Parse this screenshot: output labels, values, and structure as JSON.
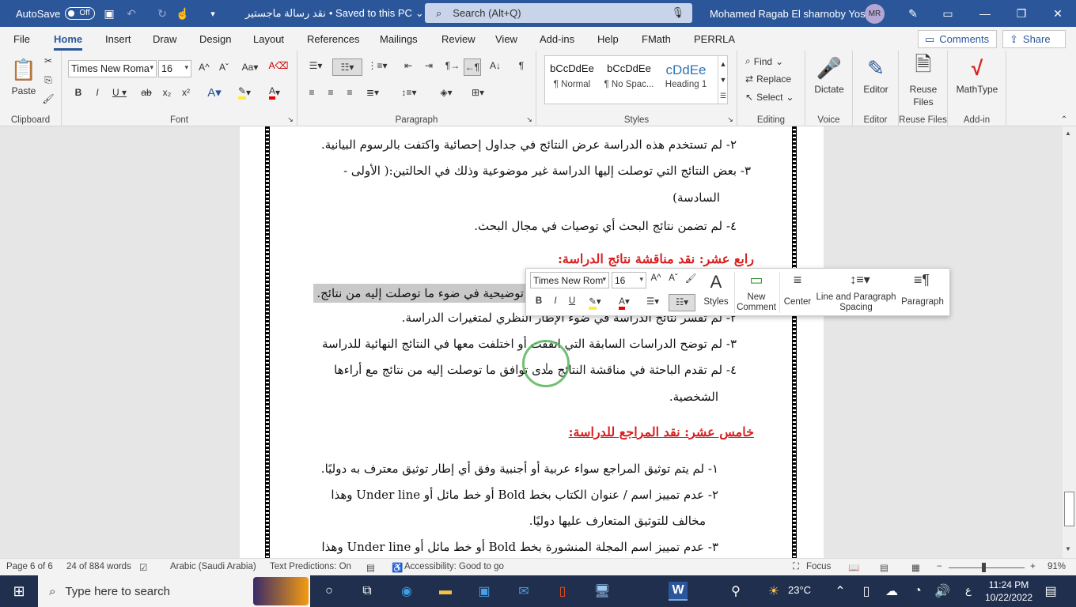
{
  "titlebar": {
    "autosave_label": "AutoSave",
    "autosave_state": "Off",
    "doc_name": "نقد رسالة ماجستير",
    "save_state": "• Saved to this PC",
    "search_placeholder": "Search (Alt+Q)",
    "user_name": "Mohamed Ragab El sharnoby Yosef",
    "user_initials": "MR"
  },
  "menu": {
    "tabs": [
      "File",
      "Home",
      "Insert",
      "Draw",
      "Design",
      "Layout",
      "References",
      "Mailings",
      "Review",
      "View",
      "Add-ins",
      "Help",
      "FMath",
      "PERRLA"
    ],
    "comments": "Comments",
    "share": "Share"
  },
  "ribbon": {
    "clipboard": {
      "paste": "Paste",
      "label": "Clipboard"
    },
    "font": {
      "name": "Times New Roma",
      "size": "16",
      "label": "Font"
    },
    "paragraph": {
      "label": "Paragraph"
    },
    "styles": {
      "label": "Styles",
      "items": [
        {
          "sample": "bCcDdEe",
          "name": "¶ Normal"
        },
        {
          "sample": "bCcDdEe",
          "name": "¶ No Spac..."
        },
        {
          "sample": "cDdEe",
          "name": "Heading 1"
        }
      ]
    },
    "editing": {
      "find": "Find",
      "replace": "Replace",
      "select": "Select",
      "label": "Editing"
    },
    "voice": {
      "dictate": "Dictate",
      "label": "Voice"
    },
    "editor": {
      "editor": "Editor",
      "label": "Editor"
    },
    "reuse": {
      "line1": "Reuse",
      "line2": "Files",
      "label": "Reuse Files"
    },
    "addin": {
      "mathtype": "MathType",
      "label": "Add-in"
    }
  },
  "document": {
    "lines": [
      "٢- لم تستخدم هذه الدراسة عرض النتائج في جداول إحصائية واكتفت بالرسوم البيانية.",
      "٣- بعض النتائج التي توصلت إليها الدراسة غير موضوعية وذلك في الحالتين:( الأولى -",
      "السادسة)",
      "٤- لم تضمن نتائج البحث أي توصيات في مجال البحث.",
      "رابع عشر: نقد مناقشة نتائج الدراسة:",
      "توضيحية في ضوء ما توصلت إليه من نتائج.",
      "٢- لم تفسر نتائج الدراسة في ضوء الإطار النظري لمتغيرات الدراسة.",
      "٣- لم توضح الدراسات السابقة التي اتفقت أو اختلفت معها في النتائج النهائية للدراسة",
      "٤- لم تقدم الباحثة في مناقشة النتائج مدى توافق ما توصلت إليه من نتائج مع أراءها",
      "الشخصية.",
      "خامس عشر: نقد المراجع للدراسة:",
      "١- لم يتم توثيق المراجع سواء عربية أو أجنبية وفق أي إطار توثيق معترف به دوليًا.",
      "٢- عدم تمييز اسم / عنوان الكتاب بخط  Bold أو خط مائل أو Under line وهذا",
      "مخالف للتوثيق المتعارف عليها دوليًا.",
      "٣- عدم تمييز اسم المجلة المنشورة بخط Bold أو خط مائل أو Under line وهذا"
    ]
  },
  "minitoolbar": {
    "font": "Times New Rom",
    "size": "16",
    "styles": "Styles",
    "new_comment_1": "New",
    "new_comment_2": "Comment",
    "center": "Center",
    "spacing_1": "Line and Paragraph",
    "spacing_2": "Spacing",
    "paragraph": "Paragraph"
  },
  "status": {
    "page": "Page 6 of 6",
    "words": "24 of 884 words",
    "language": "Arabic (Saudi Arabia)",
    "predictions": "Text Predictions: On",
    "accessibility": "Accessibility: Good to go",
    "focus": "Focus",
    "zoom": "91%",
    "zoom_level": 0.45
  },
  "taskbar": {
    "search_placeholder": "Type here to search",
    "temperature": "23°C",
    "lang": "ع",
    "time": "11:24 PM",
    "date": "10/22/2022"
  },
  "colors": {
    "word_blue": "#2b579a",
    "heading_red": "#d81f1f",
    "taskbar": "#202f4e"
  }
}
